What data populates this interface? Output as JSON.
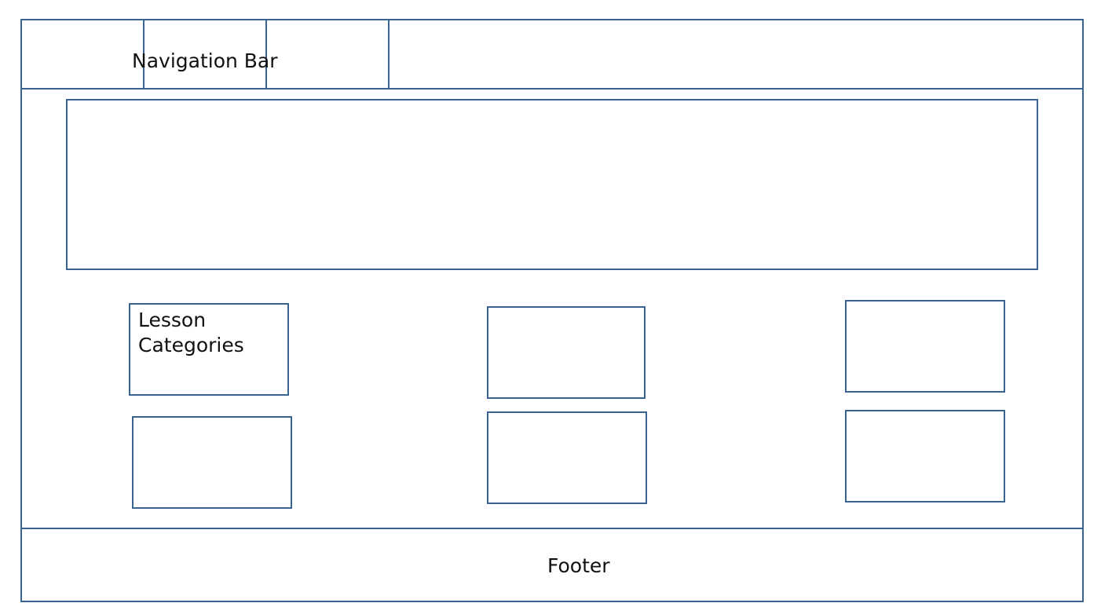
{
  "navbar": {
    "label": "Navigation Bar"
  },
  "categories": {
    "label": "Lesson\nCategories"
  },
  "footer": {
    "label": "Footer"
  },
  "colors": {
    "stroke": "#3b6391",
    "text": "#111111",
    "background": "#ffffff"
  }
}
